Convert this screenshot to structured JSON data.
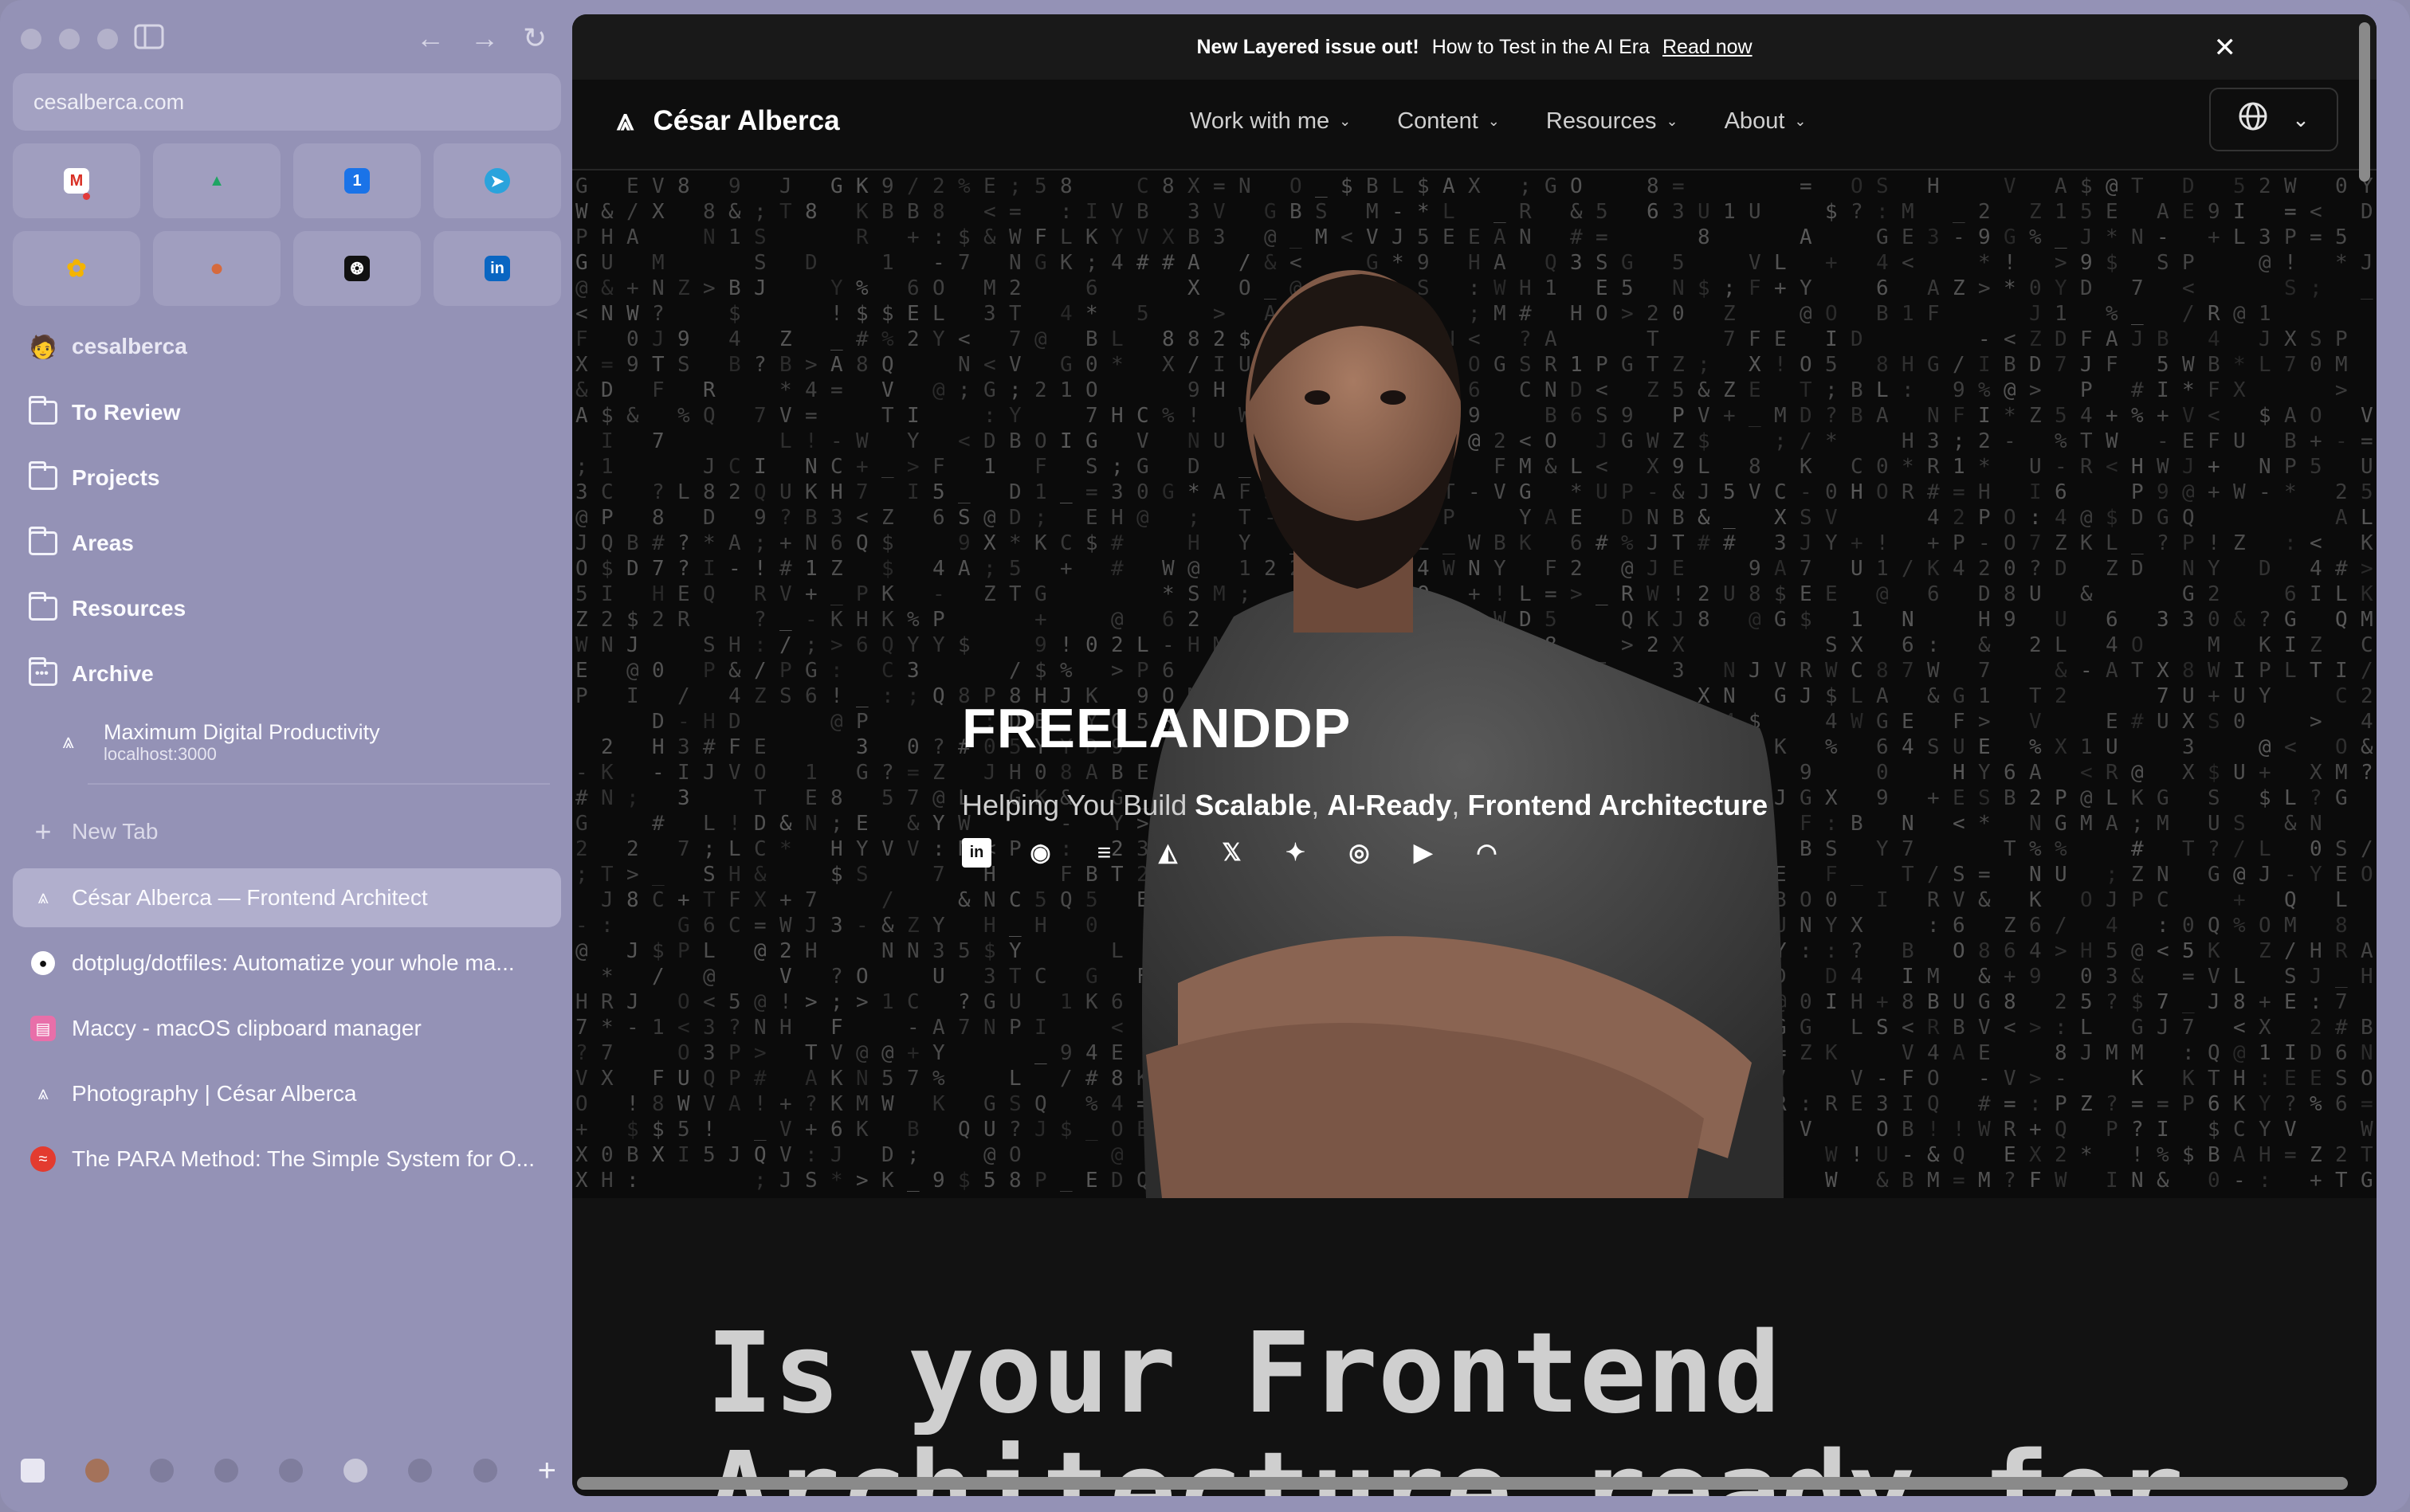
{
  "browser": {
    "url": "cesalberca.com",
    "profile_name": "cesalberca",
    "toolbar_icons": [
      "sidebar-icon",
      "back-arrow-icon",
      "forward-arrow-icon",
      "reload-icon"
    ]
  },
  "favorites": [
    {
      "name": "gmail",
      "glyph": "M",
      "color": "#d93025"
    },
    {
      "name": "google-drive",
      "glyph": "▲",
      "color": "#1fa463"
    },
    {
      "name": "calendar",
      "glyph": "1",
      "color": "#1a73e8"
    },
    {
      "name": "telegram",
      "glyph": "➤",
      "color": "#2aa3dc"
    },
    {
      "name": "photos",
      "glyph": "✿",
      "color": "#f4b400"
    },
    {
      "name": "app-orange",
      "glyph": "●",
      "color": "#d66a3d"
    },
    {
      "name": "chatgpt",
      "glyph": "❂",
      "color": "#111111"
    },
    {
      "name": "linkedin",
      "glyph": "in",
      "color": "#0a66c2"
    }
  ],
  "folders": [
    {
      "label": "To Review"
    },
    {
      "label": "Projects"
    },
    {
      "label": "Areas"
    },
    {
      "label": "Resources"
    },
    {
      "label": "Archive"
    }
  ],
  "archive_item": {
    "title": "Maximum Digital Productivity",
    "subtitle": "localhost:3000"
  },
  "new_tab_label": "New Tab",
  "tabs": [
    {
      "label": "César Alberca — Frontend Architect",
      "icon": "cesar-logo-icon",
      "selected": true
    },
    {
      "label": "dotplug/dotfiles: Automatize your whole ma...",
      "icon": "github-icon"
    },
    {
      "label": "Maccy - macOS clipboard manager",
      "icon": "maccy-icon"
    },
    {
      "label": "Photography | César Alberca",
      "icon": "cesar-logo-icon"
    },
    {
      "label": "The PARA Method: The Simple System for O...",
      "icon": "para-icon"
    }
  ],
  "page": {
    "banner": {
      "bold": "New Layered issue out!",
      "text": "How to Test in the AI Era",
      "link": "Read now"
    },
    "brand": "César Alberca",
    "nav": [
      "Work with me",
      "Content",
      "Resources",
      "About"
    ],
    "hero": {
      "title": "FREELANDDP",
      "sub_prefix": "Helping You Build",
      "sub_b1": "Scalable",
      "sub_b2": "AI-Ready",
      "sub_b3": "Frontend Architecture",
      "comma": ","
    },
    "social_icons": [
      "linkedin-icon",
      "github-icon",
      "stackoverflow-icon",
      "dev-icon",
      "x-icon",
      "bluesky-icon",
      "instagram-icon",
      "youtube-icon",
      "rss-icon"
    ],
    "headline_line1": "Is your Frontend",
    "headline_line2": "Architecture ready for"
  }
}
